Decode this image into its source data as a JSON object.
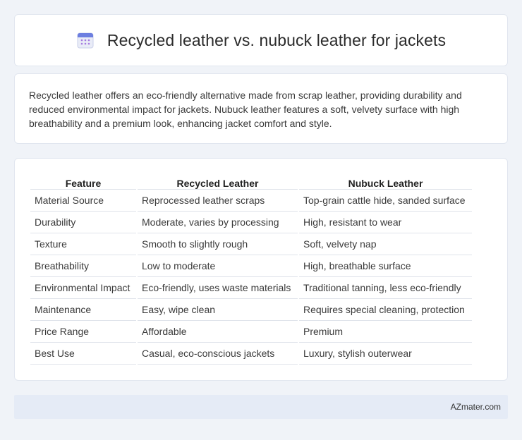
{
  "header": {
    "title": "Recycled leather vs. nubuck leather for jackets",
    "icon": "calendar-icon"
  },
  "intro": {
    "text": "Recycled leather offers an eco-friendly alternative made from scrap leather, providing durability and reduced environmental impact for jackets. Nubuck leather features a soft, velvety surface with high breathability and a premium look, enhancing jacket comfort and style."
  },
  "table": {
    "headers": [
      "Feature",
      "Recycled Leather",
      "Nubuck Leather"
    ],
    "rows": [
      [
        "Material Source",
        "Reprocessed leather scraps",
        "Top-grain cattle hide, sanded surface"
      ],
      [
        "Durability",
        "Moderate, varies by processing",
        "High, resistant to wear"
      ],
      [
        "Texture",
        "Smooth to slightly rough",
        "Soft, velvety nap"
      ],
      [
        "Breathability",
        "Low to moderate",
        "High, breathable surface"
      ],
      [
        "Environmental Impact",
        "Eco-friendly, uses waste materials",
        "Traditional tanning, less eco-friendly"
      ],
      [
        "Maintenance",
        "Easy, wipe clean",
        "Requires special cleaning, protection"
      ],
      [
        "Price Range",
        "Affordable",
        "Premium"
      ],
      [
        "Best Use",
        "Casual, eco-conscious jackets",
        "Luxury, stylish outerwear"
      ]
    ]
  },
  "footer": {
    "text": "AZmater.com"
  }
}
